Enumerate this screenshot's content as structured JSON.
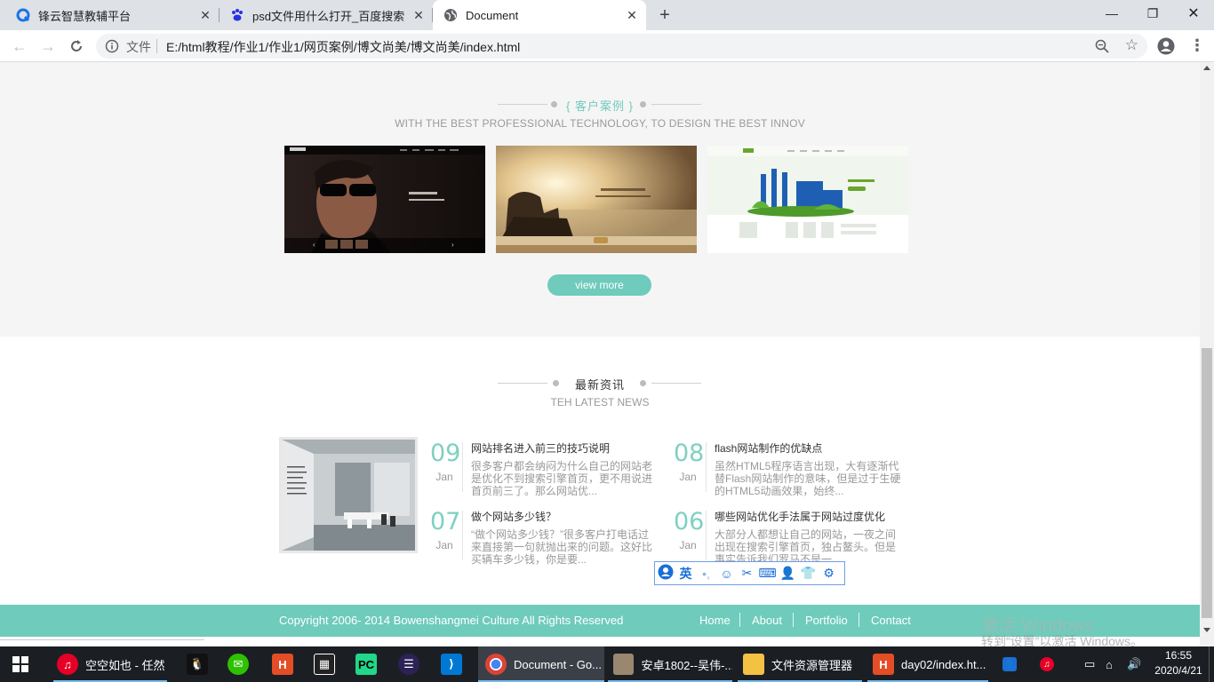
{
  "browser": {
    "tabs": [
      {
        "title": "锋云智慧教辅平台"
      },
      {
        "title": "psd文件用什么打开_百度搜索"
      },
      {
        "title": "Document"
      }
    ],
    "omnibox": {
      "scheme_label": "文件",
      "url": "E:/html教程/作业1/作业1/网页案例/博文尚美/博文尚美/index.html"
    }
  },
  "page": {
    "cases": {
      "title": "{ 客户案例 }",
      "subtitle": "WITH THE BEST PROFESSIONAL TECHNOLOGY, TO DESIGN THE BEST INNOV",
      "view_more": "view more"
    },
    "news": {
      "title": "最新资讯",
      "subtitle": "TEH LATEST NEWS",
      "items": [
        {
          "day": "09",
          "month": "Jan",
          "title": "网站排名进入前三的技巧说明",
          "body": "很多客户都会纳闷为什么自己的网站老是优化不到搜索引擎首页，更不用说进首页前三了。那么网站优..."
        },
        {
          "day": "08",
          "month": "Jan",
          "title": "flash网站制作的优缺点",
          "body": "虽然HTML5程序语言出现，大有逐渐代替Flash网站制作的意味，但是过于生硬的HTML5动画效果，始终..."
        },
        {
          "day": "07",
          "month": "Jan",
          "title": "做个网站多少钱？",
          "body": "“做个网站多少钱？”很多客户打电话过来直接第一句就抛出来的问题。这好比买辆车多少钱，你是要..."
        },
        {
          "day": "06",
          "month": "Jan",
          "title": "哪些网站优化手法属于网站过度优化",
          "body": "大部分人都想让自己的网站，一夜之间出现在搜索引擎首页，独占鳌头。但是事实告诉我们罗马不是一..."
        }
      ]
    },
    "footer": {
      "copyright": "Copyright 2006- 2014 Bowenshangmei Culture All Rights Reserved",
      "nav": [
        "Home",
        "About",
        "Portfolio",
        "Contact"
      ]
    },
    "ime_label": "英",
    "watermark": {
      "line1": "激活 Windows",
      "line2": "转到“设置”以激活 Windows。"
    }
  },
  "taskbar": {
    "items": [
      {
        "label": "空空如也 - 任然",
        "icon": "netease-music-icon"
      },
      {
        "label": "Document - Go...",
        "icon": "chrome-icon"
      },
      {
        "label": "安卓1802--吴伟-...",
        "icon": "user-photo-icon"
      },
      {
        "label": "文件资源管理器",
        "icon": "folder-icon"
      },
      {
        "label": "day02/index.ht...",
        "icon": "hbuilder-icon"
      }
    ],
    "time": "16:55",
    "date": "2020/4/21"
  },
  "colors": {
    "accent": "#6fcbbb",
    "chrome_tabbar": "#dee1e6",
    "taskbar": "#1b1f24"
  }
}
